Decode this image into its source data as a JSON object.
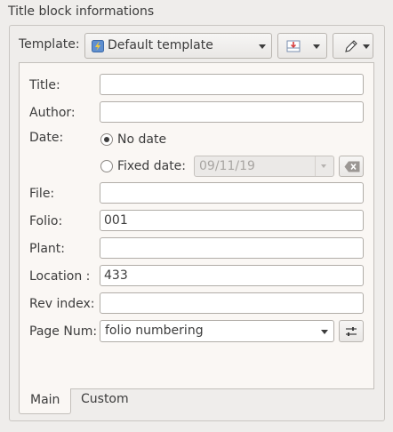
{
  "group": {
    "title": "Title block informations"
  },
  "template": {
    "label": "Template:",
    "selected": "Default template",
    "icon": "lightning-template-icon"
  },
  "toolbar": {
    "insert_icon": "table-insert-icon",
    "edit_icon": "pencil-icon"
  },
  "form": {
    "title_label": "Title:",
    "title_value": "",
    "author_label": "Author:",
    "author_value": "",
    "date_label": "Date:",
    "no_date_label": "No date",
    "fixed_date_label": "Fixed date:",
    "fixed_date_value": "09/11/19",
    "date_mode": "no-date",
    "file_label": "File:",
    "file_value": "",
    "folio_label": "Folio:",
    "folio_value": "001",
    "plant_label": "Plant:",
    "plant_value": "",
    "location_label": "Location :",
    "location_value": "433",
    "rev_label": "Rev index:",
    "rev_value": "",
    "page_num_label": "Page Num:",
    "page_num_value": "folio numbering"
  },
  "tabs": [
    {
      "label": "Main",
      "active": true
    },
    {
      "label": "Custom",
      "active": false
    }
  ]
}
